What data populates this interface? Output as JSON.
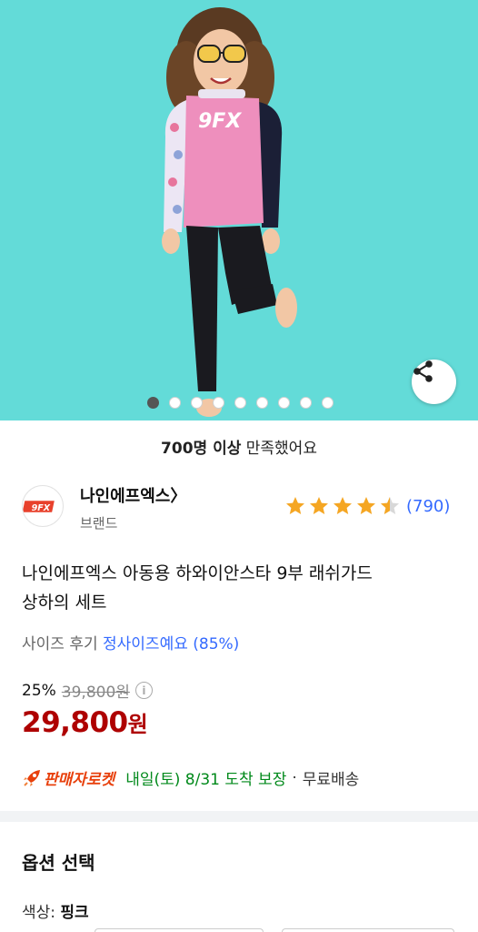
{
  "hero": {
    "background_color": "#63dbd8",
    "shirt_logo_text": "9FX",
    "active_slide": 1,
    "slide_count": 9
  },
  "share": {
    "icon": "share-icon"
  },
  "satisfaction": {
    "bold": "700명 이상",
    "rest": " 만족했어요"
  },
  "brand": {
    "name": "나인에프엑스",
    "chevron": "〉",
    "sub": "브랜드",
    "logo_text": "9FX"
  },
  "rating": {
    "stars": 4.5,
    "count": "(790)",
    "star_color": "#f5a623"
  },
  "product": {
    "title_line1": "나인에프엑스 아동용 하와이안스타 9부 래쉬가드",
    "title_line2": "상하의 세트"
  },
  "size_review": {
    "label": "사이즈 후기",
    "value": "정사이즈예요 (85%)"
  },
  "pricing": {
    "discount": "25%",
    "original": "39,800원",
    "info": "i",
    "price": "29,800",
    "price_unit": "원",
    "price_color": "#ae0000"
  },
  "delivery": {
    "badge": "판매자로켓",
    "arrival": "내일(토) 8/31 도착 보장",
    "separator": "·",
    "shipping": "무료배송",
    "arrival_color": "#00891a"
  },
  "options": {
    "title": "옵션 선택",
    "color_label": "색상:",
    "color_value": "핑크"
  }
}
